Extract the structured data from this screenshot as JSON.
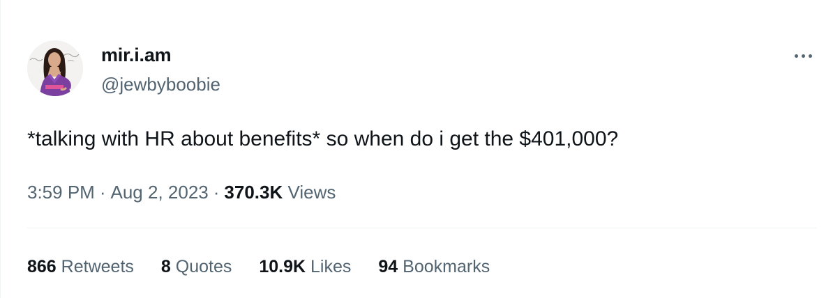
{
  "author": {
    "display_name": "mir.i.am",
    "handle": "@jewbyboobie"
  },
  "tweet": {
    "text": "*talking with HR about benefits* so when do i get the $401,000?",
    "time": "3:59 PM",
    "date": "Aug 2, 2023",
    "separator": "·",
    "views_count": "370.3K",
    "views_label": "Views"
  },
  "stats": {
    "retweets_count": "866",
    "retweets_label": "Retweets",
    "quotes_count": "8",
    "quotes_label": "Quotes",
    "likes_count": "10.9K",
    "likes_label": "Likes",
    "bookmarks_count": "94",
    "bookmarks_label": "Bookmarks"
  },
  "icons": {
    "more": "more-horizontal-icon"
  },
  "colors": {
    "primary_text": "#0f1419",
    "secondary_text": "#536471",
    "divider": "#eff3f4"
  }
}
